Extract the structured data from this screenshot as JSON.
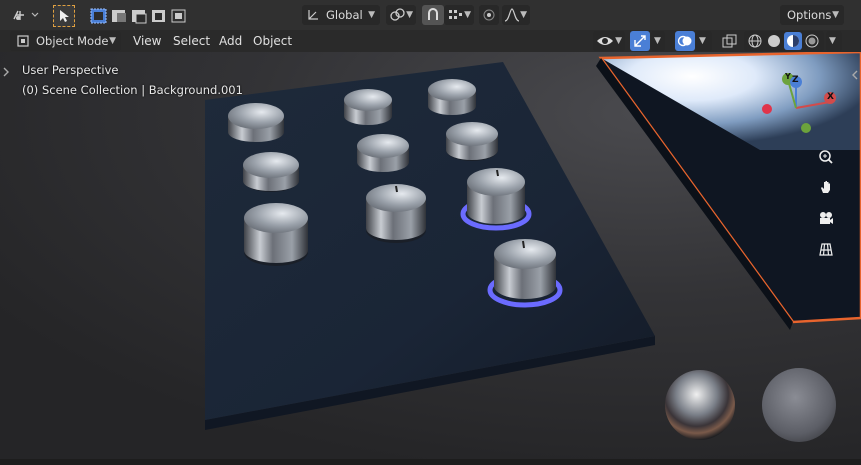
{
  "header": {
    "transform_orientation": "Global",
    "options_label": "Options"
  },
  "menu": {
    "mode": "Object Mode",
    "items": [
      "View",
      "Select",
      "Add",
      "Object"
    ]
  },
  "viewport": {
    "view_name": "User Perspective",
    "collection_info": "(0) Scene Collection | Background.001"
  },
  "gizmo": {
    "z_label": "Z",
    "y_label": "Y",
    "x_label": "X"
  },
  "colors": {
    "accent": "#4a7fd6",
    "selection_outline": "#e8642d",
    "knob_glow": "#6b6bff"
  },
  "icons": [
    "editor-type-icon",
    "select-tool-icon",
    "box-select-mode-icons",
    "transform-orientation-icon",
    "pivot-icon",
    "snap-icon",
    "proportional-edit-icon",
    "visibility-icon",
    "gizmo-icon",
    "overlay-icon",
    "xray-icon",
    "shading-wireframe-icon",
    "shading-solid-icon",
    "shading-material-icon",
    "shading-rendered-icon",
    "zoom-icon",
    "hand-pan-icon",
    "camera-icon",
    "grid-ortho-icon"
  ]
}
